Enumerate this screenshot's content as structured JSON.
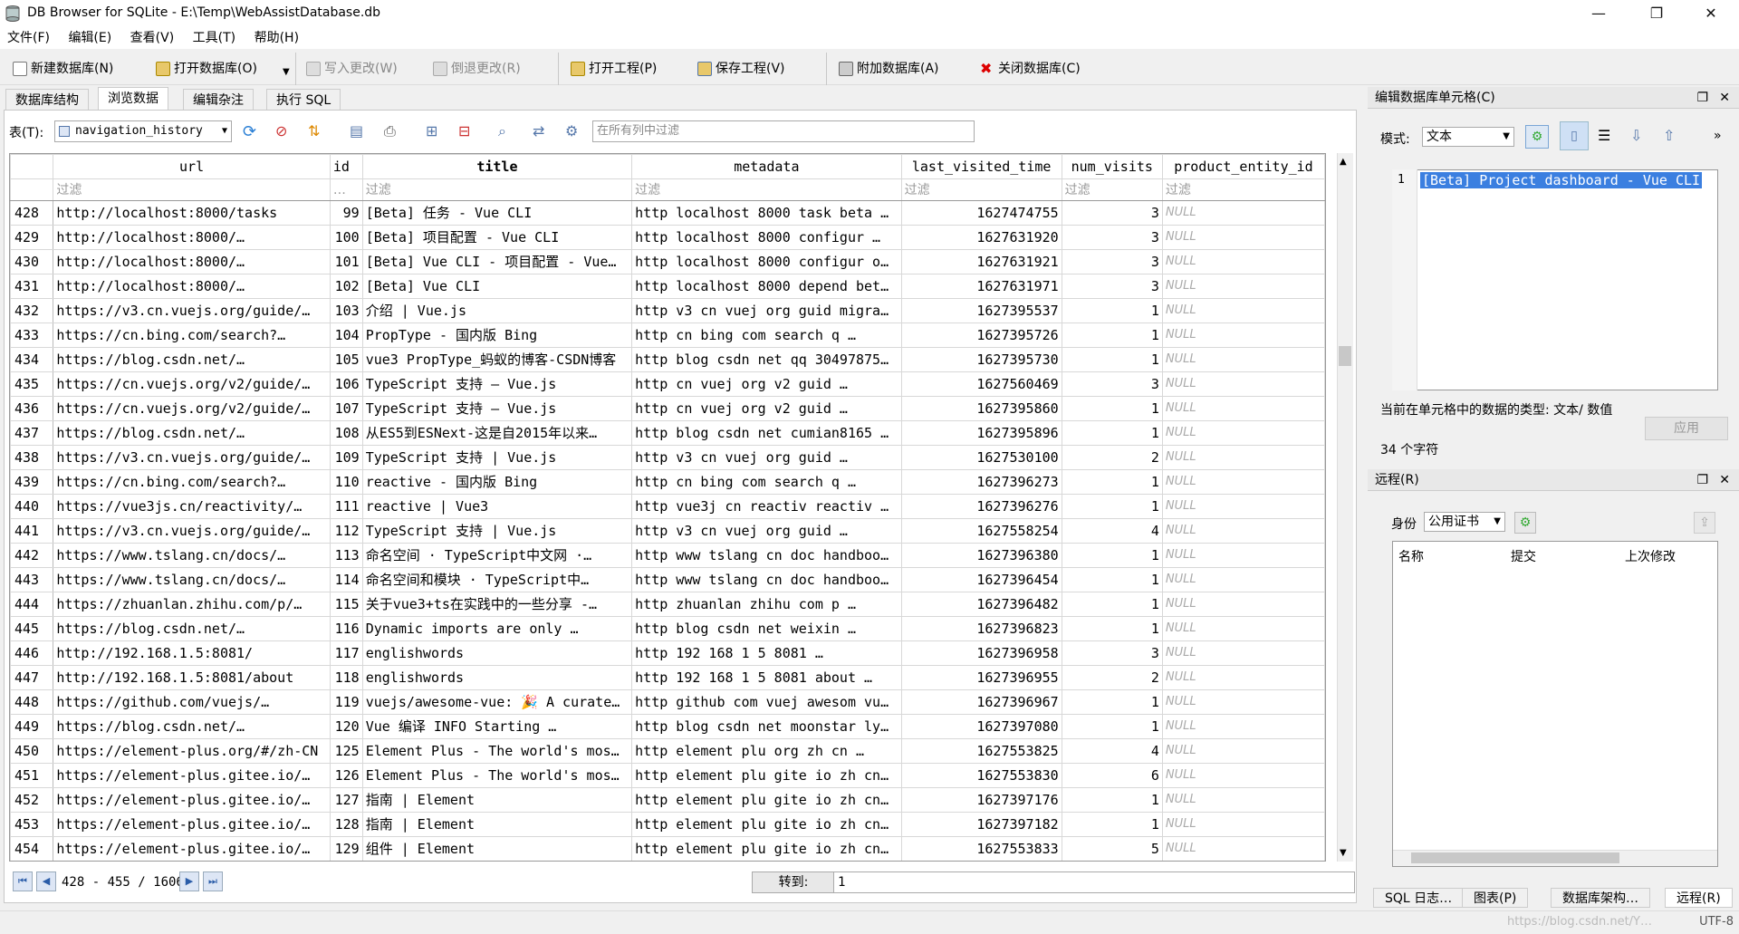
{
  "window": {
    "title": "DB Browser for SQLite - E:\\Temp\\WebAssistDatabase.db",
    "minimize": "—",
    "maximize": "❐",
    "close": "✕"
  },
  "menu": [
    "文件(F)",
    "编辑(E)",
    "查看(V)",
    "工具(T)",
    "帮助(H)"
  ],
  "toolbar": {
    "new_db": "新建数据库(N)",
    "open_db": "打开数据库(O)",
    "write_changes": "写入更改(W)",
    "revert_changes": "倒退更改(R)",
    "open_project": "打开工程(P)",
    "save_project": "保存工程(V)",
    "attach_db": "附加数据库(A)",
    "close_db": "关闭数据库(C)"
  },
  "tabs": [
    "数据库结构",
    "浏览数据",
    "编辑杂注",
    "执行 SQL"
  ],
  "browse": {
    "table_label": "表(T):",
    "table_name": "navigation_history",
    "filter_placeholder": "在所有列中过滤",
    "columns": [
      "url",
      "id",
      "title",
      "metadata",
      "last_visited_time",
      "num_visits",
      "product_entity_id"
    ],
    "filter_row": [
      "过滤",
      "…",
      "过滤",
      "过滤",
      "过滤",
      "过滤",
      "过滤"
    ],
    "rows": [
      [
        "428",
        "http://localhost:8000/tasks",
        "99",
        "[Beta] 任务 - Vue CLI",
        "http localhost 8000 task beta …",
        "1627474755",
        "3",
        "NULL"
      ],
      [
        "429",
        "http://localhost:8000/…",
        "100",
        "[Beta] 项目配置 - Vue CLI",
        "http localhost 8000 configur …",
        "1627631920",
        "3",
        "NULL"
      ],
      [
        "430",
        "http://localhost:8000/…",
        "101",
        "[Beta] Vue CLI - 项目配置 - Vue…",
        "http localhost 8000 configur o…",
        "1627631921",
        "3",
        "NULL"
      ],
      [
        "431",
        "http://localhost:8000/…",
        "102",
        "[Beta] Vue CLI",
        "http localhost 8000 depend bet…",
        "1627631971",
        "3",
        "NULL"
      ],
      [
        "432",
        "https://v3.cn.vuejs.org/guide/…",
        "103",
        "介绍 | Vue.js",
        "http v3 cn vuej org guid migra…",
        "1627395537",
        "1",
        "NULL"
      ],
      [
        "433",
        "https://cn.bing.com/search?…",
        "104",
        "PropType - 国内版 Bing",
        "http cn bing com search q …",
        "1627395726",
        "1",
        "NULL"
      ],
      [
        "434",
        "https://blog.csdn.net/…",
        "105",
        "vue3 PropType_蚂蚁的博客-CSDN博客",
        "http blog csdn net qq 30497875…",
        "1627395730",
        "1",
        "NULL"
      ],
      [
        "435",
        "https://cn.vuejs.org/v2/guide/…",
        "106",
        "TypeScript 支持 — Vue.js",
        "http cn vuej org v2 guid …",
        "1627560469",
        "3",
        "NULL"
      ],
      [
        "436",
        "https://cn.vuejs.org/v2/guide/…",
        "107",
        "TypeScript 支持 — Vue.js",
        "http cn vuej org v2 guid …",
        "1627395860",
        "1",
        "NULL"
      ],
      [
        "437",
        "https://blog.csdn.net/…",
        "108",
        "从ES5到ESNext-这是自2015年以来…",
        "http blog csdn net cumian8165 …",
        "1627395896",
        "1",
        "NULL"
      ],
      [
        "438",
        "https://v3.cn.vuejs.org/guide/…",
        "109",
        "TypeScript 支持 | Vue.js",
        "http v3 cn vuej org guid …",
        "1627530100",
        "2",
        "NULL"
      ],
      [
        "439",
        "https://cn.bing.com/search?…",
        "110",
        "reactive - 国内版 Bing",
        "http cn bing com search q …",
        "1627396273",
        "1",
        "NULL"
      ],
      [
        "440",
        "https://vue3js.cn/reactivity/…",
        "111",
        "reactive | Vue3",
        "http vue3j cn reactiv reactiv …",
        "1627396276",
        "1",
        "NULL"
      ],
      [
        "441",
        "https://v3.cn.vuejs.org/guide/…",
        "112",
        "TypeScript 支持 | Vue.js",
        "http v3 cn vuej org guid …",
        "1627558254",
        "4",
        "NULL"
      ],
      [
        "442",
        "https://www.tslang.cn/docs/…",
        "113",
        "命名空间 · TypeScript中文网 ·…",
        "http www tslang cn doc handboo…",
        "1627396380",
        "1",
        "NULL"
      ],
      [
        "443",
        "https://www.tslang.cn/docs/…",
        "114",
        "命名空间和模块 · TypeScript中…",
        "http www tslang cn doc handboo…",
        "1627396454",
        "1",
        "NULL"
      ],
      [
        "444",
        "https://zhuanlan.zhihu.com/p/…",
        "115",
        "关于vue3+ts在实践中的一些分享 -…",
        "http zhuanlan zhihu com p …",
        "1627396482",
        "1",
        "NULL"
      ],
      [
        "445",
        "https://blog.csdn.net/…",
        "116",
        "Dynamic imports are only …",
        "http blog csdn net weixin …",
        "1627396823",
        "1",
        "NULL"
      ],
      [
        "446",
        "http://192.168.1.5:8081/",
        "117",
        "englishwords",
        "http 192 168 1 5 8081 …",
        "1627396958",
        "3",
        "NULL"
      ],
      [
        "447",
        "http://192.168.1.5:8081/about",
        "118",
        "englishwords",
        "http 192 168 1 5 8081 about …",
        "1627396955",
        "2",
        "NULL"
      ],
      [
        "448",
        "https://github.com/vuejs/…",
        "119",
        "vuejs/awesome-vue: 🎉 A curate…",
        "http github com vuej awesom vu…",
        "1627396967",
        "1",
        "NULL"
      ],
      [
        "449",
        "https://blog.csdn.net/…",
        "120",
        "Vue 编译 INFO Starting …",
        "http blog csdn net moonstar ly…",
        "1627397080",
        "1",
        "NULL"
      ],
      [
        "450",
        "https://element-plus.org/#/zh-CN",
        "125",
        "Element Plus - The world's mos…",
        "http element plu org zh cn …",
        "1627553825",
        "4",
        "NULL"
      ],
      [
        "451",
        "https://element-plus.gitee.io/…",
        "126",
        "Element Plus - The world's mos…",
        "http element plu gite io zh cn…",
        "1627553830",
        "6",
        "NULL"
      ],
      [
        "452",
        "https://element-plus.gitee.io/…",
        "127",
        "指南 | Element",
        "http element plu gite io zh cn…",
        "1627397176",
        "1",
        "NULL"
      ],
      [
        "453",
        "https://element-plus.gitee.io/…",
        "128",
        "指南 | Element",
        "http element plu gite io zh cn…",
        "1627397182",
        "1",
        "NULL"
      ],
      [
        "454",
        "https://element-plus.gitee.io/…",
        "129",
        "组件 | Element",
        "http element plu gite io zh cn…",
        "1627553833",
        "5",
        "NULL"
      ]
    ]
  },
  "navigation": {
    "first": "⏮",
    "prev": "◀",
    "page_info": "428 - 455 / 1606",
    "next": "▶",
    "last": "⏭",
    "goto_label": "转到:",
    "goto_value": "1"
  },
  "edit_cell": {
    "title": "编辑数据库单元格(C)",
    "mode_label": "模式:",
    "mode_value": "文本",
    "line_number": "1",
    "content": "[Beta] Project dashboard - Vue CLI",
    "type_info": "当前在单元格中的数据的类型: 文本/ 数值",
    "char_count": "34 个字符",
    "apply": "应用"
  },
  "remote": {
    "title": "远程(R)",
    "identity_label": "身份",
    "identity_value": "公用证书",
    "columns": [
      "名称",
      "提交",
      "上次修改"
    ]
  },
  "bottom_tabs": [
    "SQL 日志…",
    "图表(P)",
    "数据库架构…",
    "远程(R)"
  ],
  "status": {
    "encoding": "UTF-8",
    "watermark": "https://blog.csdn.net/Y…"
  },
  "colors": {
    "selection": "#3b7fe0",
    "null_text": "#aaaaaa",
    "nav_blue": "#2a5ca8"
  }
}
